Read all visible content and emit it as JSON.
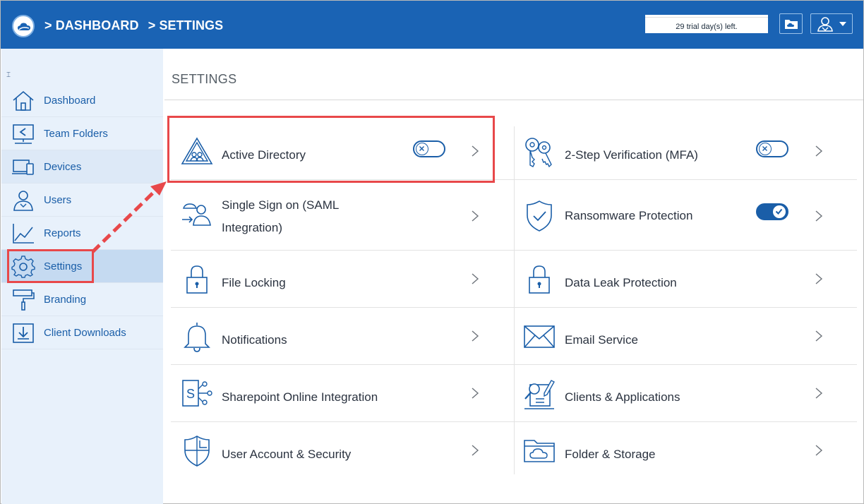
{
  "header": {
    "breadcrumb": [
      "> DASHBOARD",
      "> SETTINGS"
    ],
    "trial_text": "29 trial day(s) left.",
    "bg_color": "#1a63b4"
  },
  "sidebar": {
    "items": [
      {
        "label": "Dashboard",
        "icon": "home-icon"
      },
      {
        "label": "Team Folders",
        "icon": "team-folder-icon"
      },
      {
        "label": "Devices",
        "icon": "devices-icon"
      },
      {
        "label": "Users",
        "icon": "users-icon"
      },
      {
        "label": "Reports",
        "icon": "reports-icon"
      },
      {
        "label": "Settings",
        "icon": "gear-icon",
        "active": true
      },
      {
        "label": "Branding",
        "icon": "paint-roller-icon"
      },
      {
        "label": "Client Downloads",
        "icon": "download-icon"
      }
    ]
  },
  "main": {
    "title": "SETTINGS",
    "left_cards": [
      {
        "label": "Active Directory",
        "toggle": "off",
        "icon": "active-directory-icon"
      },
      {
        "label": "Single Sign on (SAML Integration)",
        "icon": "sso-icon"
      },
      {
        "label": "File Locking",
        "icon": "lock-icon"
      },
      {
        "label": "Notifications",
        "icon": "bell-icon"
      },
      {
        "label": "Sharepoint Online Integration",
        "icon": "sharepoint-icon"
      },
      {
        "label": "User Account & Security",
        "icon": "shield-grid-icon"
      }
    ],
    "right_cards": [
      {
        "label": "2-Step Verification (MFA)",
        "toggle": "off",
        "icon": "keys-icon"
      },
      {
        "label": "Ransomware Protection",
        "toggle": "on",
        "icon": "shield-check-icon"
      },
      {
        "label": "Data Leak Protection",
        "icon": "lock-icon"
      },
      {
        "label": "Email Service",
        "icon": "envelope-icon"
      },
      {
        "label": "Clients & Applications",
        "icon": "clients-apps-icon"
      },
      {
        "label": "Folder & Storage",
        "icon": "folder-cloud-icon"
      }
    ]
  },
  "colors": {
    "accent": "#1a5ea8",
    "highlight": "#e8484a"
  }
}
